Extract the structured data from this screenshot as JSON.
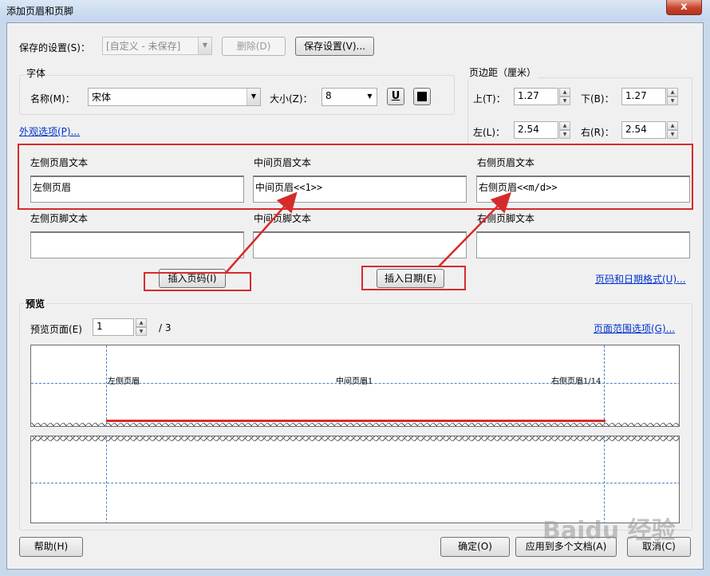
{
  "window": {
    "title": "添加页眉和页脚",
    "close_label": "x"
  },
  "saved_settings": {
    "label": "保存的设置(S)：",
    "value": "[自定义 - 未保存]",
    "delete_label": "删除(D)",
    "save_label": "保存设置(V)..."
  },
  "font": {
    "group_label": "字体",
    "name_label": "名称(M)：",
    "name_value": "宋体",
    "size_label": "大小(Z)：",
    "size_value": "8",
    "underline_label": "U"
  },
  "margins": {
    "group_label": "页边距（厘米）",
    "top_label": "上(T)：",
    "top_value": "1.27",
    "bottom_label": "下(B)：",
    "bottom_value": "1.27",
    "left_label": "左(L)：",
    "left_value": "2.54",
    "right_label": "右(R)：",
    "right_value": "2.54"
  },
  "appearance_link": "外观选项(P)...",
  "header": {
    "left_label": "左侧页眉文本",
    "left_value": "左侧页眉",
    "center_label": "中间页眉文本",
    "center_value": "中间页眉<<1>>",
    "right_label": "右侧页眉文本",
    "right_value": "右侧页眉<<m/d>>"
  },
  "footer": {
    "left_label": "左侧页脚文本",
    "left_value": "",
    "center_label": "中间页脚文本",
    "center_value": "",
    "right_label": "右侧页脚文本",
    "right_value": ""
  },
  "insert_page_number_label": "插入页码(I)",
  "insert_date_label": "插入日期(E)",
  "page_date_format_link": "页码和日期格式(U)...",
  "preview": {
    "group_label": "预览",
    "page_label": "预览页面(E)",
    "page_value": "1",
    "page_total": "/ 3",
    "range_link": "页面范围选项(G)...",
    "left_text": "左侧页眉",
    "center_text": "中间页眉1",
    "right_text": "右侧页眉1/14"
  },
  "buttons": {
    "help": "帮助(H)",
    "ok": "确定(O)",
    "apply_multiple": "应用到多个文档(A)",
    "cancel": "取消(C)"
  },
  "watermark_text": "Baidu 经验",
  "annotation_color": "#d62b2b"
}
